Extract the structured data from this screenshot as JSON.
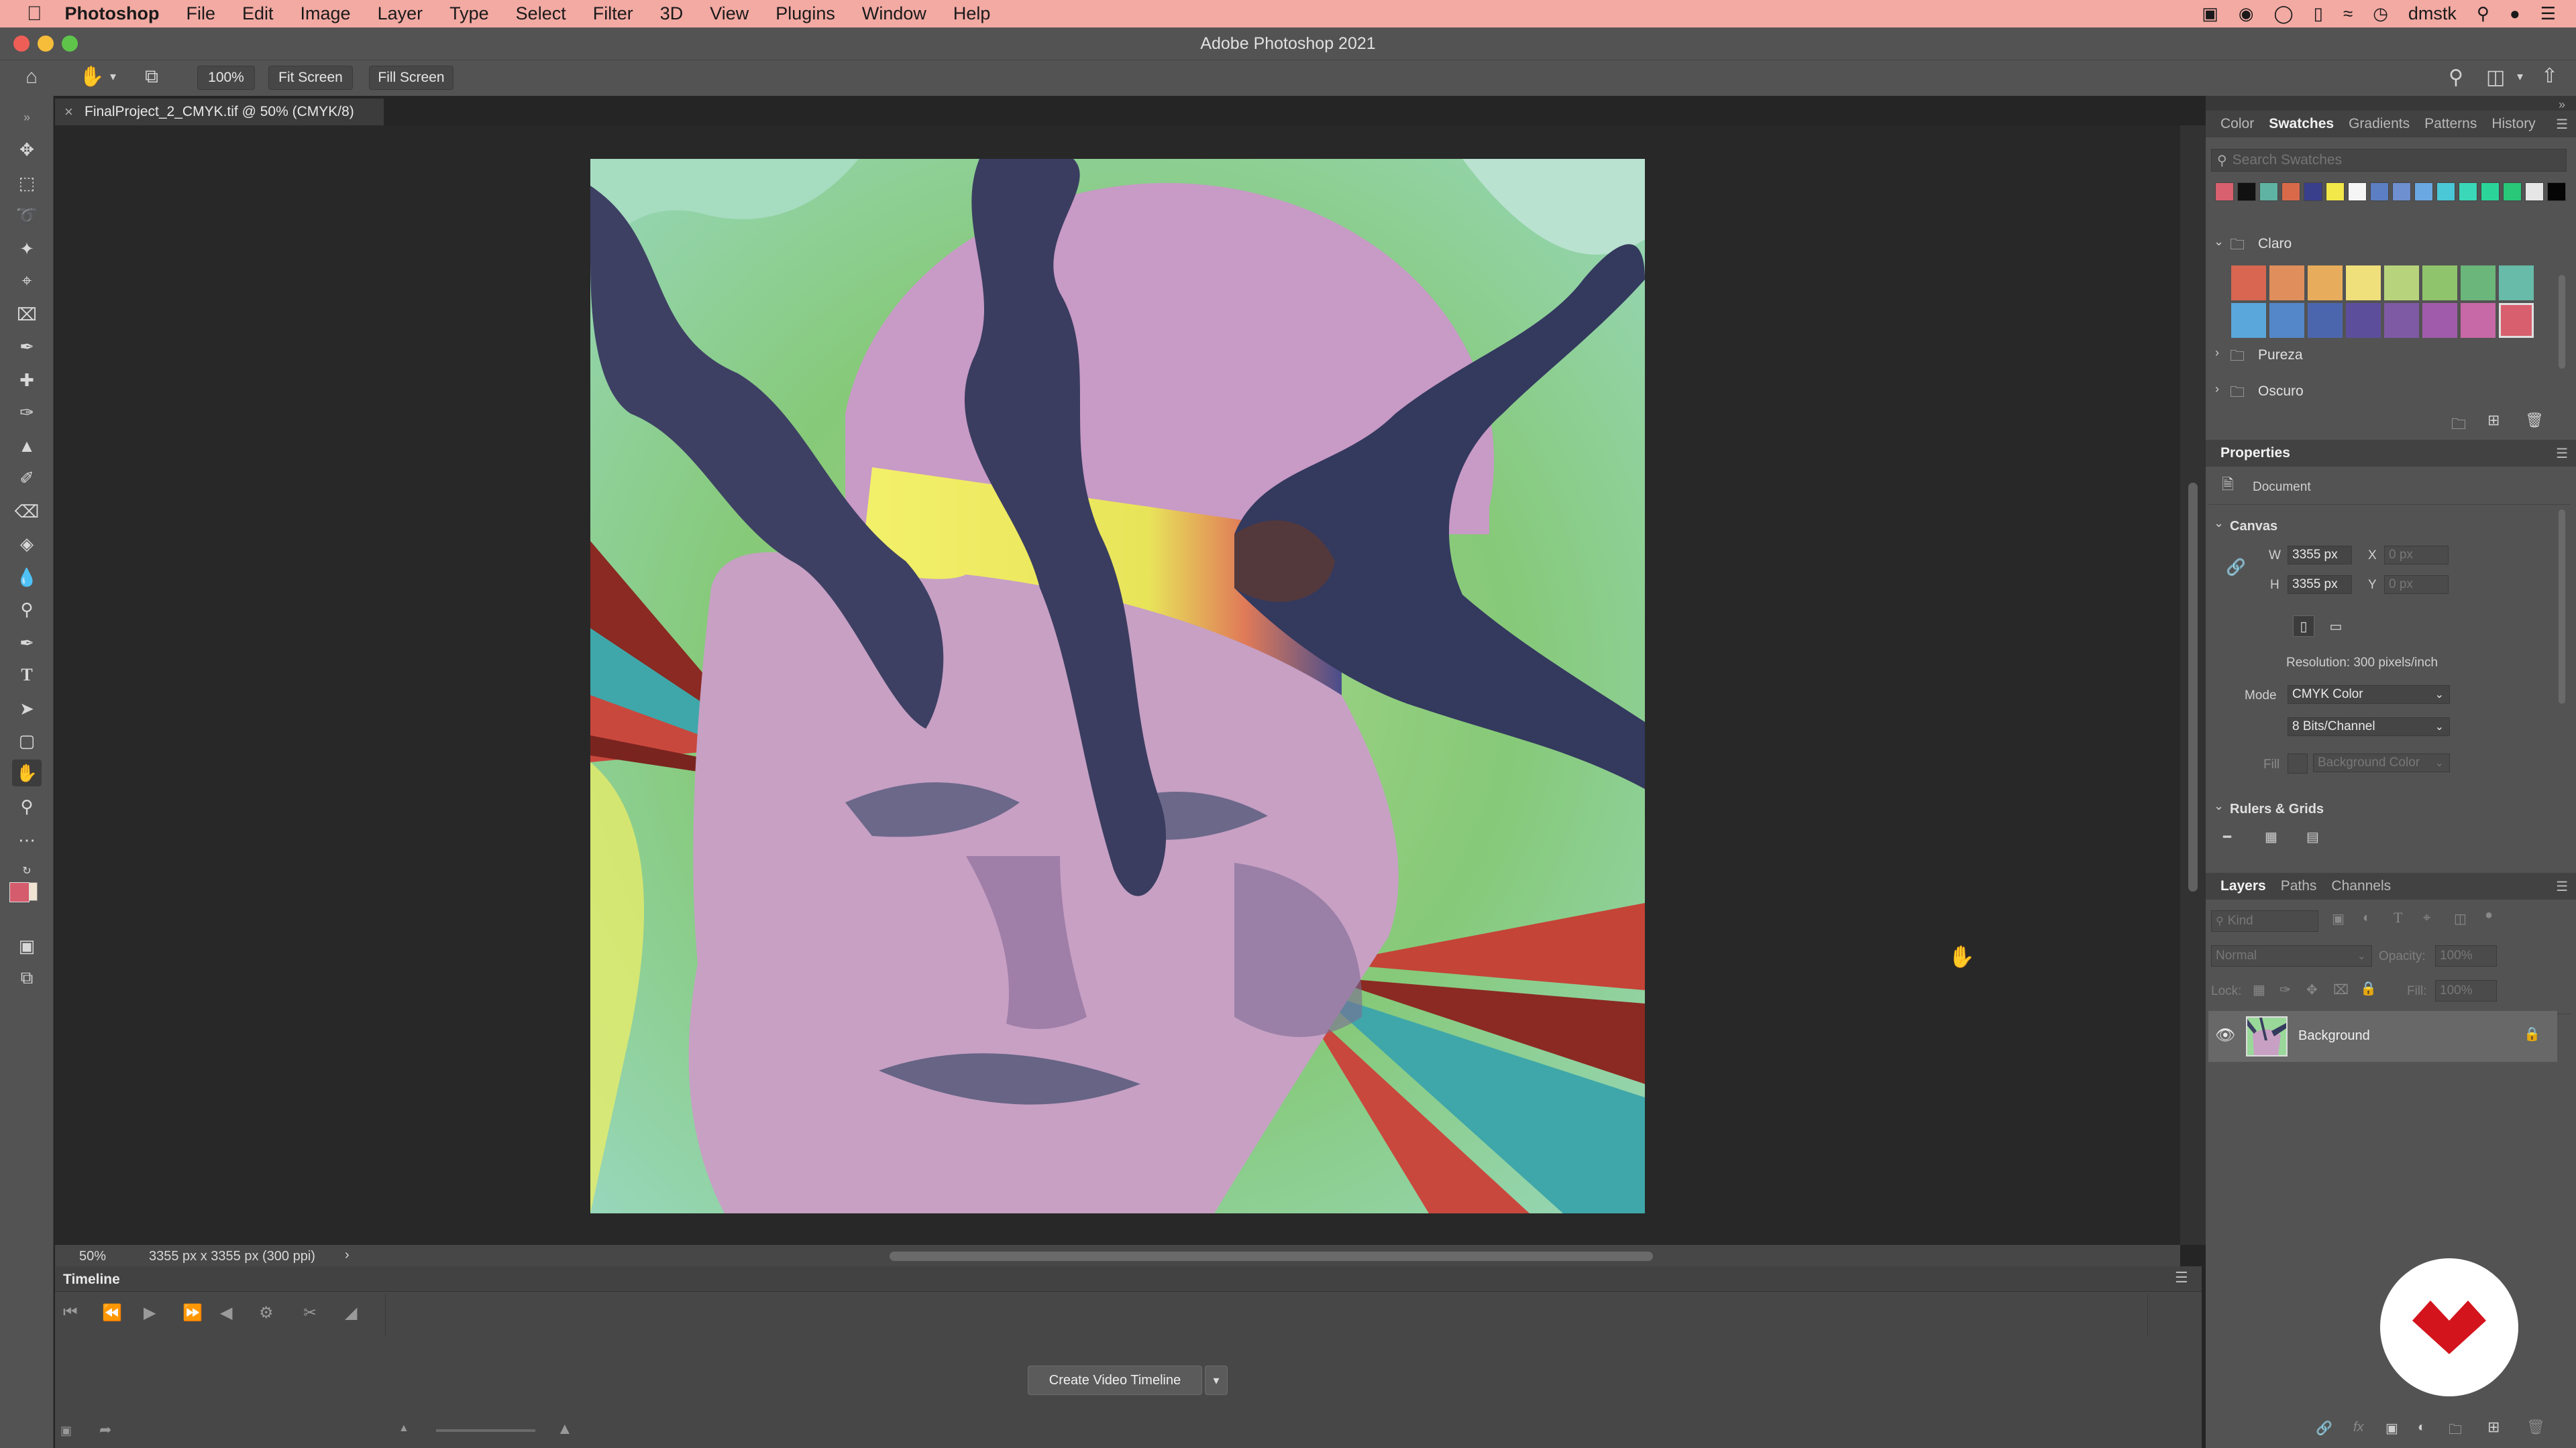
{
  "menubar": {
    "app_name": "Photoshop",
    "items": [
      "File",
      "Edit",
      "Image",
      "Layer",
      "Type",
      "Select",
      "Filter",
      "3D",
      "View",
      "Plugins",
      "Window",
      "Help"
    ],
    "user": "dmstk"
  },
  "window": {
    "title": "Adobe Photoshop 2021"
  },
  "options": {
    "zoom_level": "100%",
    "fit_screen": "Fit Screen",
    "fill_screen": "Fill Screen"
  },
  "document": {
    "tab_title": "FinalProject_2_CMYK.tif @ 50% (CMYK/8)"
  },
  "status": {
    "zoom": "50%",
    "doc_info": "3355 px x 3355 px (300 ppi)"
  },
  "timeline": {
    "title": "Timeline",
    "create_button": "Create Video Timeline"
  },
  "top_panel": {
    "tabs": [
      "Color",
      "Swatches",
      "Gradients",
      "Patterns",
      "History"
    ],
    "active_tab": "Swatches",
    "search_placeholder": "Search Swatches",
    "recent_swatches": [
      "#d9606e",
      "#111111",
      "#5fb3a3",
      "#d86a4a",
      "#3a3f8c",
      "#f2e84a",
      "#f5f5f5",
      "#5b7fc2",
      "#6e8fd0",
      "#6aa8e2",
      "#4bc8d8",
      "#3ad7b8",
      "#2bd59a",
      "#28c878",
      "#e6e6e6",
      "#050505"
    ],
    "groups": [
      {
        "name": "Claro",
        "expanded": true
      },
      {
        "name": "Pureza",
        "expanded": false
      },
      {
        "name": "Oscuro",
        "expanded": false
      }
    ],
    "claro_row1": [
      "#d86650",
      "#e08f5c",
      "#e7ad5c",
      "#f0e07c",
      "#b7d47c",
      "#8fc46c",
      "#6bb67a",
      "#67bba8"
    ],
    "claro_row2": [
      "#5aa7dc",
      "#5487c9",
      "#4c66ae",
      "#5d4e9c",
      "#7e5aa4",
      "#a05caa",
      "#c769a6",
      "#d8606e"
    ]
  },
  "properties": {
    "title": "Properties",
    "doc_label": "Document",
    "canvas_section": "Canvas",
    "w_label": "W",
    "w_value": "3355 px",
    "h_label": "H",
    "h_value": "3355 px",
    "x_label": "X",
    "x_value": "0 px",
    "y_label": "Y",
    "y_value": "0 px",
    "resolution": "Resolution: 300 pixels/inch",
    "mode_label": "Mode",
    "mode_value": "CMYK Color",
    "depth_value": "8 Bits/Channel",
    "fill_label": "Fill",
    "fill_value": "Background Color",
    "rulers_section": "Rulers & Grids"
  },
  "layers": {
    "tabs": [
      "Layers",
      "Paths",
      "Channels"
    ],
    "active_tab": "Layers",
    "kind_placeholder": "Kind",
    "blend_mode": "Normal",
    "opacity_label": "Opacity:",
    "opacity_value": "100%",
    "lock_label": "Lock:",
    "fill_label": "Fill:",
    "fill_value": "100%",
    "items": [
      {
        "name": "Background",
        "visible": true,
        "locked": true
      }
    ]
  }
}
